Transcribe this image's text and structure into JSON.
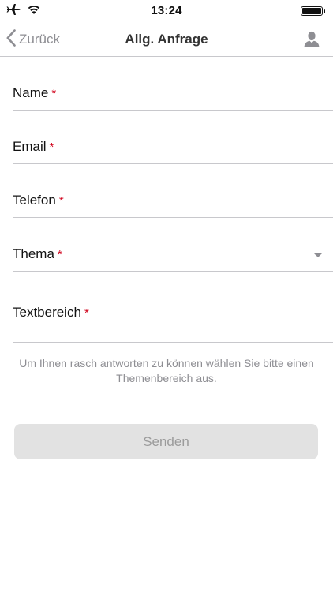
{
  "status_bar": {
    "time": "13:24",
    "icons": [
      "airplane-icon",
      "wifi-icon",
      "battery-icon"
    ],
    "battery_level": 1.0
  },
  "nav": {
    "back_label": "Zurück",
    "title": "Allg. Anfrage",
    "right_icon": "user-icon"
  },
  "form": {
    "required_mark": "*",
    "fields": [
      {
        "label": "Name",
        "type": "text",
        "value": ""
      },
      {
        "label": "Email",
        "type": "email",
        "value": ""
      },
      {
        "label": "Telefon",
        "type": "tel",
        "value": ""
      },
      {
        "label": "Thema",
        "type": "select",
        "value": ""
      },
      {
        "label": "Textbereich",
        "type": "textarea",
        "value": ""
      }
    ]
  },
  "hint": "Um Ihnen rasch antworten zu können wählen Sie bitte einen Themenbereich aus.",
  "submit_label": "Senden",
  "colors": {
    "accent_gray": "#8e8e93",
    "required_red": "#d0021b",
    "button_bg": "#e2e2e2",
    "button_text": "#9b9b9b",
    "divider": "#c8c8cc"
  }
}
